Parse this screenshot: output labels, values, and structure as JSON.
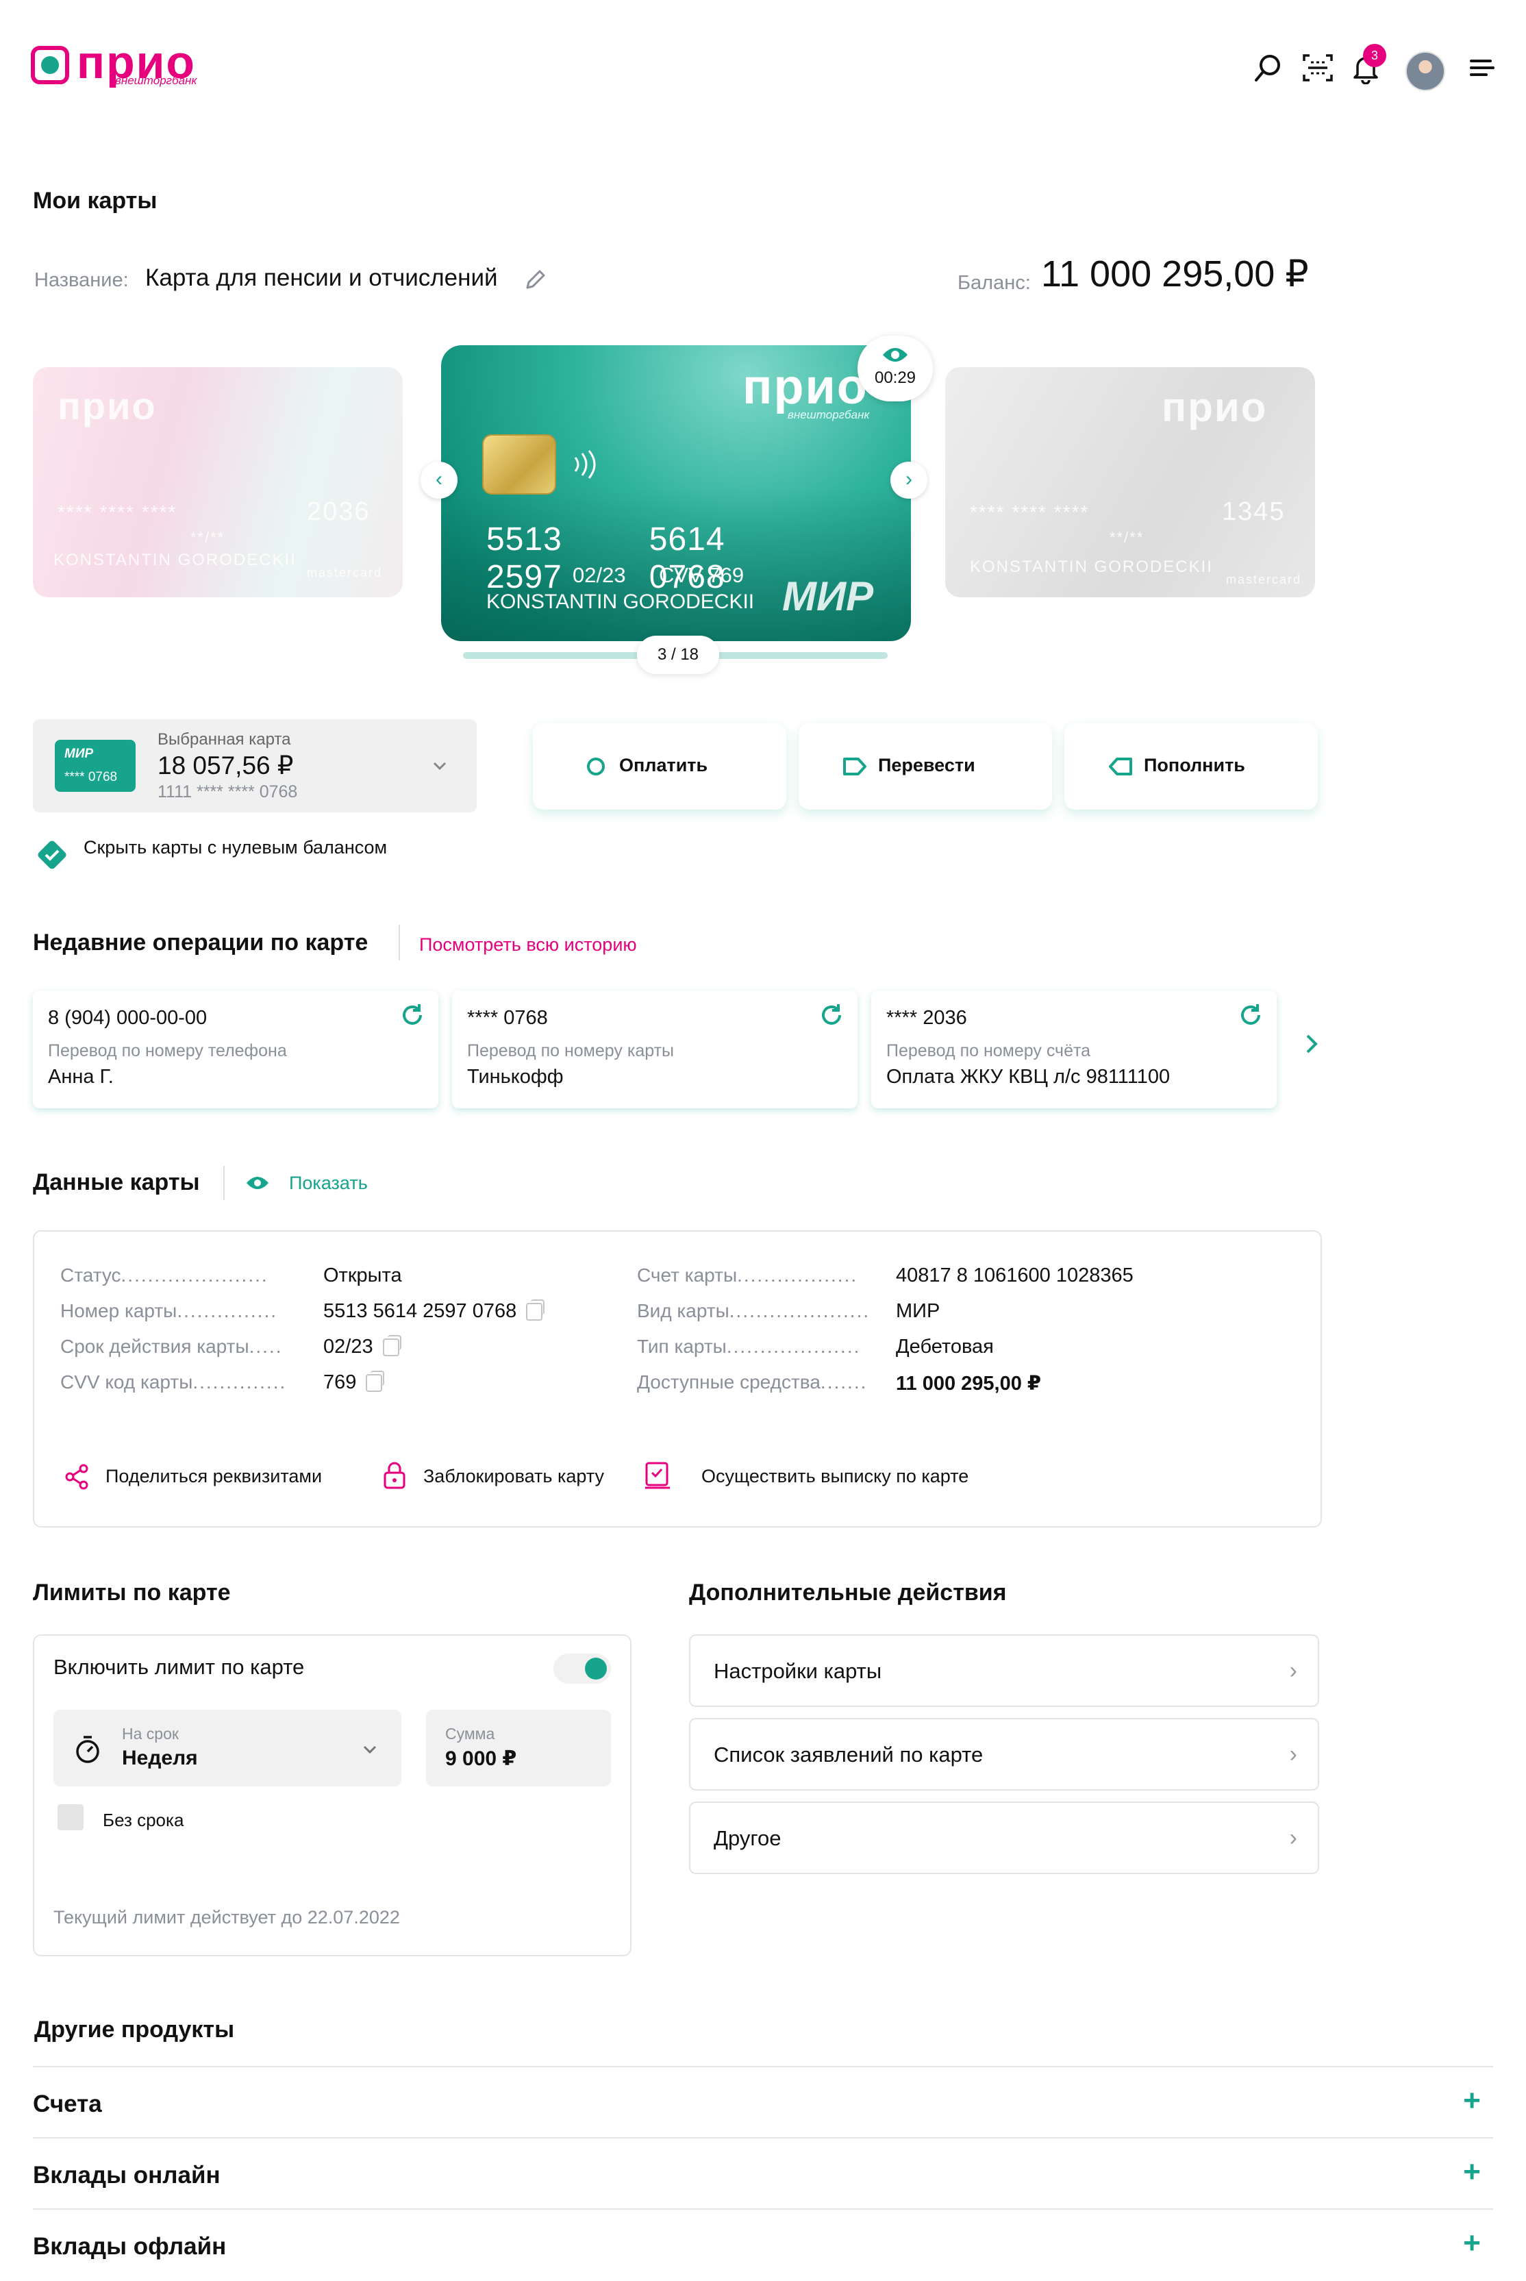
{
  "header": {
    "logo_text": "прио",
    "logo_sub": "внешторгбанк",
    "notifications_count": "3",
    "icons": [
      "search-icon",
      "scan-icon",
      "bell-icon",
      "menu-icon"
    ]
  },
  "my_cards": {
    "title": "Мои карты",
    "name_label": "Название:",
    "name_value": "Карта для пенсии и отчислений",
    "balance_label": "Баланс:",
    "balance_value": "11 000 295,00 ₽"
  },
  "carousel": {
    "left_card": {
      "brand": "прио",
      "mask": "****   ****   ****",
      "last": "2036",
      "expiry": "**/**",
      "holder": "KONSTANTIN GORODECKII",
      "network": "mastercard"
    },
    "main_card": {
      "brand": "прио",
      "brand_sub": "внешторгбанк",
      "number": [
        "5513",
        "5614",
        "2597",
        "0768"
      ],
      "expiry": "02/23",
      "cvv": "CVV 769",
      "holder": "KONSTANTIN GORODECKII",
      "network": "МИР",
      "timer": "00:29"
    },
    "right_card": {
      "brand": "прио",
      "mask": "****   ****   ****",
      "last": "1345",
      "expiry": "**/**",
      "holder": "KONSTANTIN GORODECKII",
      "network": "mastercard"
    },
    "pager": "3 / 18"
  },
  "selected_card": {
    "label": "Выбранная карта",
    "amount": "18 057,56 ₽",
    "number": "1111 **** **** 0768",
    "mini_network": "МИР",
    "mini_last": "**** 0768"
  },
  "actions": {
    "pay": "Оплатить",
    "transfer": "Перевести",
    "topup": "Пополнить"
  },
  "hide_zero": "Скрыть карты с нулевым балансом",
  "recent": {
    "title": "Недавние операции по карте",
    "history_link": "Посмотреть всю историю",
    "items": [
      {
        "target": "8 (904) 000-00-00",
        "type": "Перевод по номеру телефона",
        "name": "Анна Г."
      },
      {
        "target": "**** 0768",
        "type": "Перевод по номеру карты",
        "name": "Тинькофф"
      },
      {
        "target": "**** 2036",
        "type": "Перевод по номеру счёта",
        "name": "Оплата ЖКУ КВЦ л/с 98111100"
      }
    ]
  },
  "card_data": {
    "title": "Данные карты",
    "show": "Показать",
    "left": [
      {
        "label": "Статус",
        "value": "Открыта",
        "copy": false
      },
      {
        "label": "Номер карты",
        "value": "5513 5614 2597 0768",
        "copy": true
      },
      {
        "label": "Срок действия карты",
        "value": "02/23",
        "copy": true
      },
      {
        "label": "CVV код карты",
        "value": "769",
        "copy": true
      }
    ],
    "right": [
      {
        "label": "Счет карты",
        "value": "40817 8 1061600 1028365"
      },
      {
        "label": "Вид карты",
        "value": "МИР"
      },
      {
        "label": "Тип карты",
        "value": "Дебетовая"
      },
      {
        "label": "Доступные средства",
        "value": "11 000 295,00 ₽"
      }
    ],
    "share": "Поделиться реквизитами",
    "block": "Заблокировать карту",
    "statement": "Осуществить выписку по карте"
  },
  "limits": {
    "title": "Лимиты по карте",
    "enable": "Включить лимит по карте",
    "toggle_on": true,
    "period_label": "На срок",
    "period_value": "Неделя",
    "sum_label": "Сумма",
    "sum_value": "9 000 ₽",
    "no_term": "Без срока",
    "note": "Текущий лимит действует до 22.07.2022"
  },
  "extra": {
    "title": "Дополнительные действия",
    "items": [
      "Настройки карты",
      "Список заявлений по карте",
      "Другое"
    ]
  },
  "products": {
    "title": "Другие продукты",
    "items": [
      "Счета",
      "Вклады онлайн",
      "Вклады офлайн"
    ]
  },
  "colors": {
    "accent": "#16a48d",
    "brand": "#e6007e"
  }
}
